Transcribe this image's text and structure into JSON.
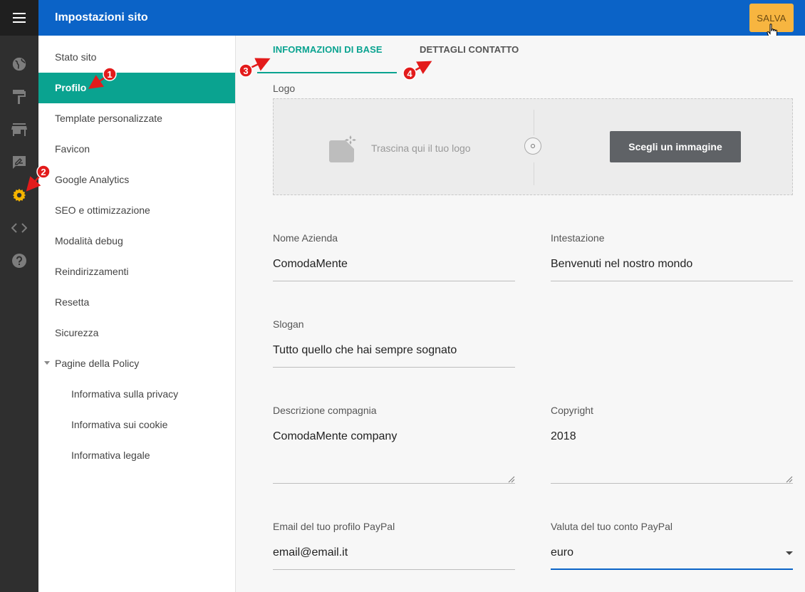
{
  "header": {
    "title": "Impostazioni sito",
    "save_label": "SALVA"
  },
  "rail": {
    "icons": [
      "menu-icon",
      "globe-icon",
      "paint-roller-icon",
      "store-icon",
      "feedback-icon",
      "gear-icon",
      "code-icon",
      "help-icon"
    ]
  },
  "sidebar": {
    "items": [
      {
        "label": "Stato sito"
      },
      {
        "label": "Profilo"
      },
      {
        "label": "Template personalizzate"
      },
      {
        "label": "Favicon"
      },
      {
        "label": "Google Analytics"
      },
      {
        "label": "SEO e ottimizzazione"
      },
      {
        "label": "Modalità debug"
      },
      {
        "label": "Reindirizzamenti"
      },
      {
        "label": "Resetta"
      },
      {
        "label": "Sicurezza"
      },
      {
        "label": "Pagine della Policy"
      }
    ],
    "policy_items": [
      {
        "label": "Informativa sulla privacy"
      },
      {
        "label": "Informativa sui cookie"
      },
      {
        "label": "Informativa legale"
      }
    ]
  },
  "tabs": [
    {
      "label": "INFORMAZIONI DI BASE"
    },
    {
      "label": "DETTAGLI CONTATTO"
    }
  ],
  "logo": {
    "label": "Logo",
    "drop_text": "Trascina qui il tuo logo",
    "choose_label": "Scegli un immagine"
  },
  "form": {
    "company_name": {
      "label": "Nome Azienda",
      "value": "ComodaMente"
    },
    "heading": {
      "label": "Intestazione",
      "value": "Benvenuti nel nostro mondo"
    },
    "slogan": {
      "label": "Slogan",
      "value": "Tutto quello che hai sempre sognato"
    },
    "description": {
      "label": "Descrizione compagnia",
      "value": "ComodaMente company"
    },
    "copyright": {
      "label": "Copyright",
      "value": "2018"
    },
    "paypal_email": {
      "label": "Email del tuo profilo PayPal",
      "value": "email@email.it"
    },
    "paypal_currency": {
      "label": "Valuta del tuo conto PayPal",
      "value": "euro"
    }
  },
  "annotations": [
    "1",
    "2",
    "3",
    "4"
  ],
  "colors": {
    "accent": "#0aa390",
    "topbar": "#0b63c7",
    "save": "#f7b540",
    "rail": "#2f2f2f",
    "annotation": "#e31b1b",
    "gear_active": "#f5b400"
  }
}
